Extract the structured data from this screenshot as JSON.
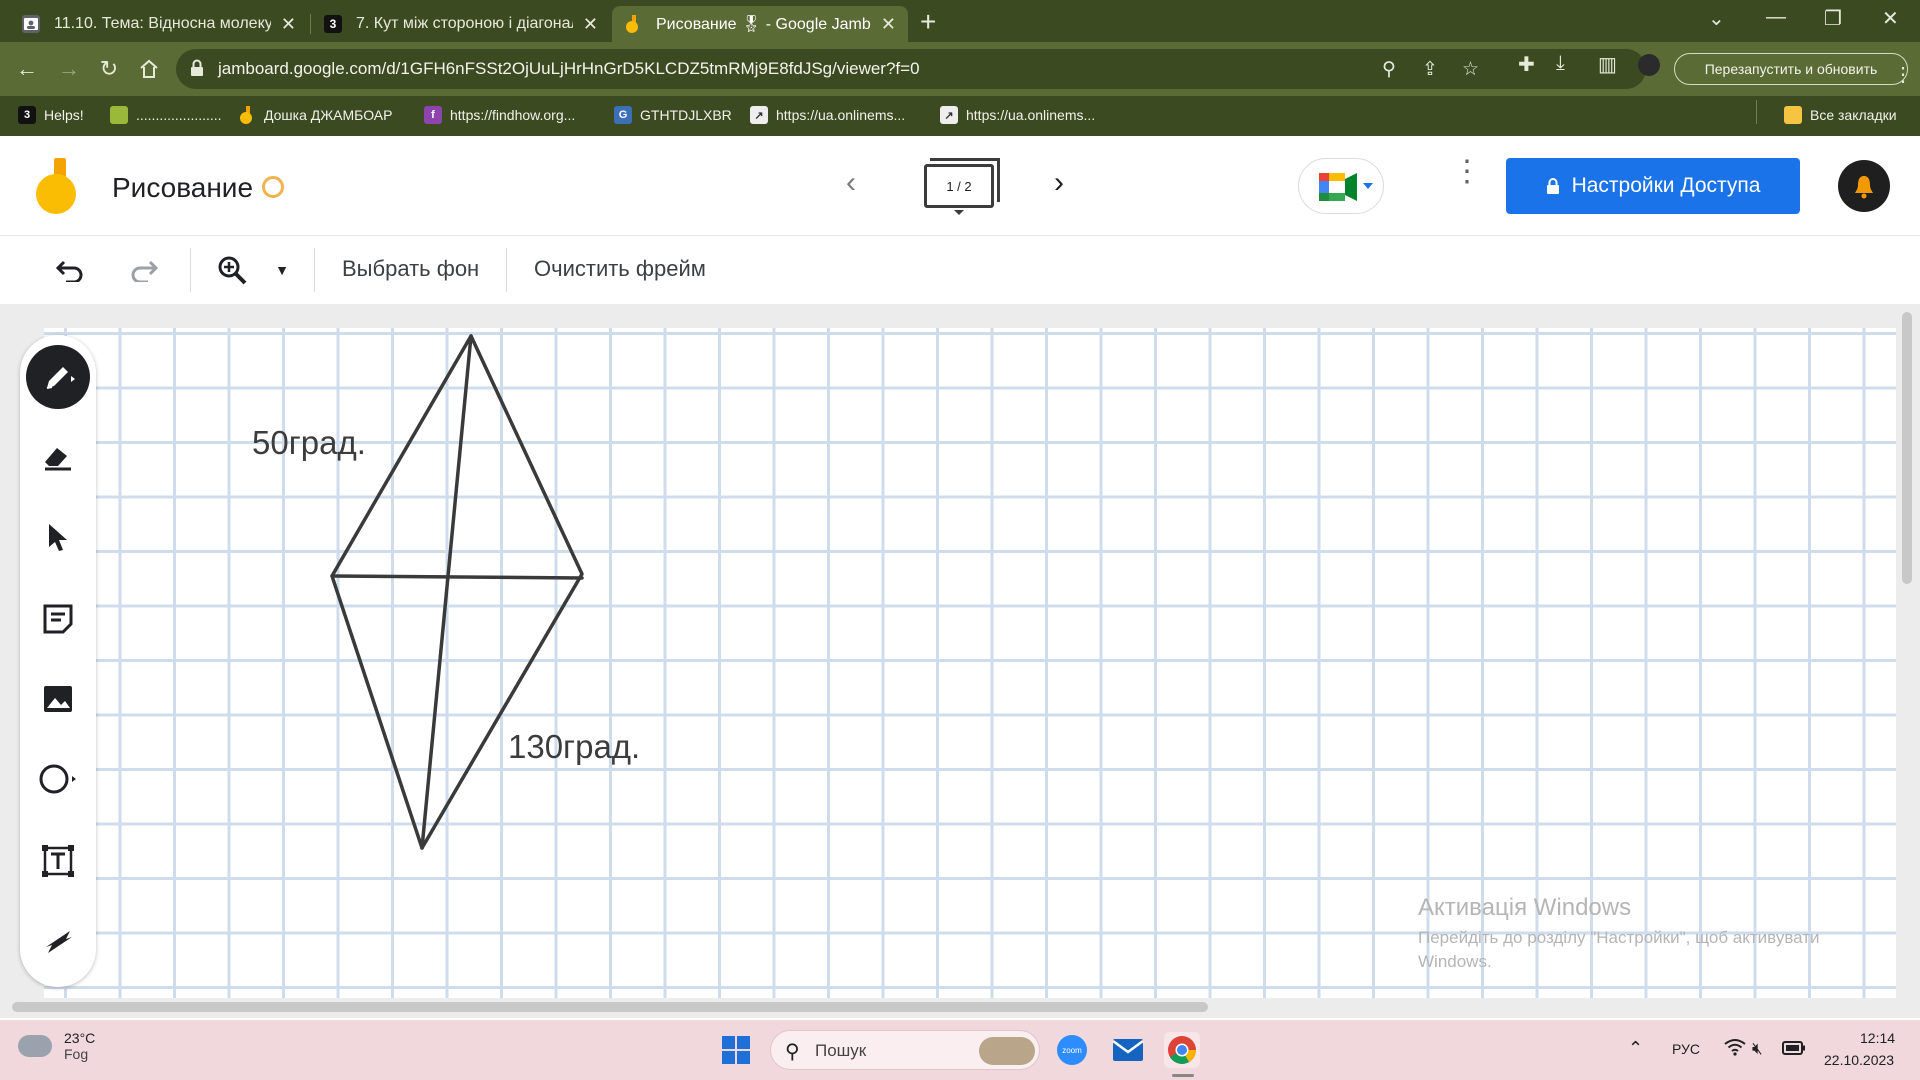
{
  "browser": {
    "tabs": [
      {
        "title": "11.10. Тема: Відносна молекулярна",
        "favicon_color": "#5f6368"
      },
      {
        "title": "7. Кут між стороною і діагоналлю",
        "favicon_letter": "3",
        "favicon_color": "#111111"
      },
      {
        "title": "Рисование 🎖 - Google Jamboard",
        "favicon_color": "#fbbc04",
        "active": true
      }
    ],
    "url": "jamboard.google.com/d/1GFH6nFSSt2OjUuLjHrHnGrD5KLCDZ5tmRMj9E8fdJSg/viewer?f=0",
    "relaunch_label": "Перезапустить и обновить",
    "bookmarks": [
      {
        "label": "Helps!",
        "icon": "3"
      },
      {
        "label": "......................",
        "icon": "img"
      },
      {
        "label": "Дошка ДЖАМБОАР",
        "icon": "jam"
      },
      {
        "label": "https://findhow.org...",
        "icon": "fh"
      },
      {
        "label": "GTHTDJLXBR",
        "icon": "gt"
      },
      {
        "label": "https://ua.onlinems...",
        "icon": "om"
      },
      {
        "label": "https://ua.onlinems...",
        "icon": "om"
      }
    ],
    "all_bookmarks_label": "Все закладки"
  },
  "app": {
    "title": "Рисование",
    "frame_indicator": "1 / 2",
    "share_label": "Настройки Доступа",
    "brand_color": "#1a73e8"
  },
  "toolbar": {
    "background_label": "Выбрать фон",
    "clear_label": "Очистить фрейм"
  },
  "canvas": {
    "labels": {
      "angle_top": "50град.",
      "angle_bottom": "130град."
    }
  },
  "watermark": {
    "title": "Активація Windows",
    "body": "Перейдіть до розділу \"Настройки\", щоб активувати Windows."
  },
  "taskbar": {
    "weather_temp": "23°C",
    "weather_condition": "Fog",
    "search_placeholder": "Пошук",
    "language": "РУС",
    "time": "12:14",
    "date": "22.10.2023"
  }
}
